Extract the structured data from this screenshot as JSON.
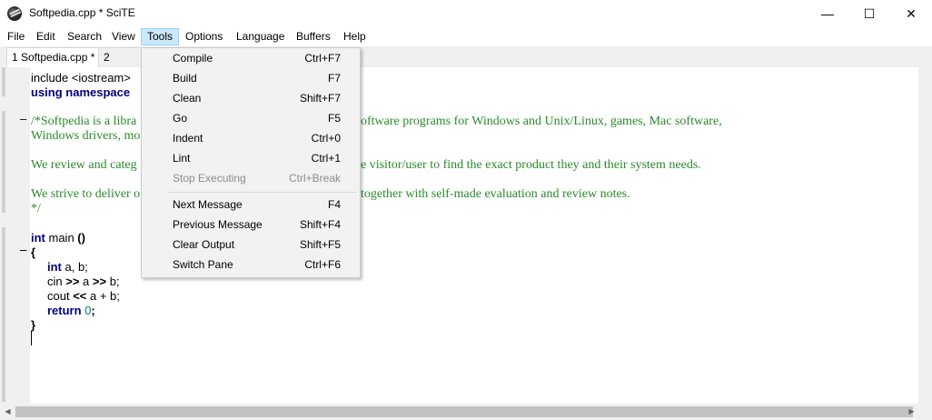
{
  "window": {
    "title": "Softpedia.cpp * SciTE",
    "icon": "scite-app-icon",
    "minimize_glyph": "—",
    "maximize_glyph": "☐",
    "close_glyph": "✕"
  },
  "menubar": {
    "items": [
      "File",
      "Edit",
      "Search",
      "View",
      "Tools",
      "Options",
      "Language",
      "Buffers",
      "Help"
    ],
    "active": "Tools"
  },
  "tabs": [
    {
      "label": "1 Softpedia.cpp *",
      "active": true
    },
    {
      "label": "2 Softpe",
      "active": false
    }
  ],
  "tools_menu": {
    "groups": [
      [
        {
          "label": "Compile",
          "shortcut": "Ctrl+F7",
          "enabled": true
        },
        {
          "label": "Build",
          "shortcut": "F7",
          "enabled": true
        },
        {
          "label": "Clean",
          "shortcut": "Shift+F7",
          "enabled": true
        },
        {
          "label": "Go",
          "shortcut": "F5",
          "enabled": true
        },
        {
          "label": "Indent",
          "shortcut": "Ctrl+0",
          "enabled": true
        },
        {
          "label": "Lint",
          "shortcut": "Ctrl+1",
          "enabled": true
        },
        {
          "label": "Stop Executing",
          "shortcut": "Ctrl+Break",
          "enabled": false
        }
      ],
      [
        {
          "label": "Next Message",
          "shortcut": "F4",
          "enabled": true
        },
        {
          "label": "Previous Message",
          "shortcut": "Shift+F4",
          "enabled": true
        },
        {
          "label": "Clear Output",
          "shortcut": "Shift+F5",
          "enabled": true
        },
        {
          "label": "Switch Pane",
          "shortcut": "Ctrl+F6",
          "enabled": true
        }
      ]
    ]
  },
  "editor": {
    "lines": {
      "l1_text": "include <iostream>",
      "l2_kw": "using namespace",
      "l3_a": "/*Softpedia is a libra",
      "l3_b": "oftware programs for Windows and Unix/Linux, games, Mac software,",
      "l4_a": "Windows drivers, mo",
      "l5_a": "We review and categ",
      "l5_b": "e visitor/user to find the exact product they and their system needs.",
      "l6_a": "We strive to deliver o",
      "l6_b": "together with self-made evaluation and review notes.",
      "l7": "*/",
      "l8_kw": "int",
      "l8_rest": " main ",
      "l8_parens": "()",
      "l9": "{",
      "l10_kw": "int",
      "l10_rest": " a, b;",
      "l11_a": "cin ",
      "l11_op1": ">>",
      "l11_b": " a ",
      "l11_op2": ">>",
      "l11_c": " b;",
      "l12_a": "cout ",
      "l12_op": "<<",
      "l12_b": " a + b;",
      "l13_kw": "return",
      "l13_sp": " ",
      "l13_num": "0",
      "l13_end": ";",
      "l14": "}"
    },
    "fold_markers": [
      "–",
      "–",
      "–"
    ]
  },
  "colors": {
    "keyword": "#00007f",
    "comment": "#2a8a2a",
    "number": "#007f7f",
    "menu_highlight": "#cce8ff"
  }
}
